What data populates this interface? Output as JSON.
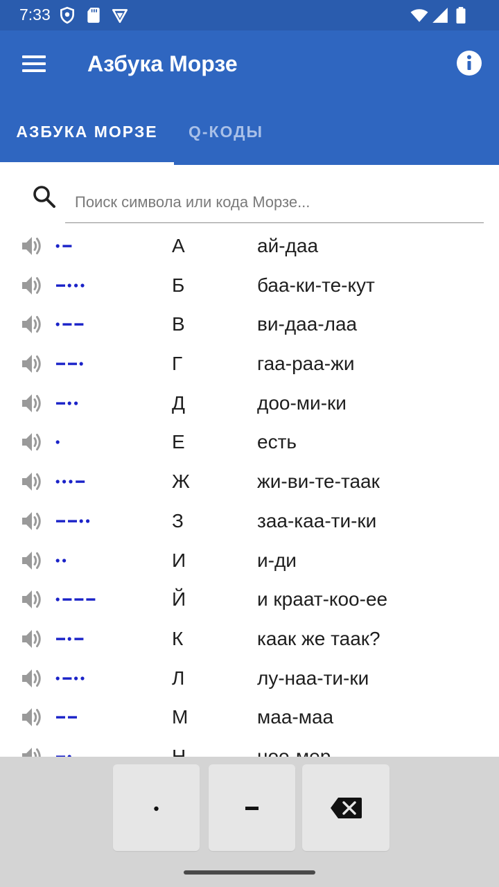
{
  "status": {
    "time": "7:33"
  },
  "appbar": {
    "title": "Азбука Морзе"
  },
  "tabs": [
    {
      "label": "АЗБУКА МОРЗЕ",
      "active": true
    },
    {
      "label": "Q-КОДЫ",
      "active": false
    }
  ],
  "search": {
    "value": "",
    "placeholder": "Поиск символа или кода Морзе..."
  },
  "colors": {
    "primary": "#2f66c0",
    "status": "#2a5cae",
    "morse": "#1a22c8",
    "speaker": "#9a9a9a"
  },
  "rows": [
    {
      "code": ".-",
      "letter": "А",
      "mnemonic": "ай-даа"
    },
    {
      "code": "-...",
      "letter": "Б",
      "mnemonic": "баа-ки-те-кут"
    },
    {
      "code": ".--",
      "letter": "В",
      "mnemonic": "ви-даа-лаа"
    },
    {
      "code": "--.",
      "letter": "Г",
      "mnemonic": "гаа-раа-жи"
    },
    {
      "code": "-..",
      "letter": "Д",
      "mnemonic": "доо-ми-ки"
    },
    {
      "code": ".",
      "letter": "Е",
      "mnemonic": "есть"
    },
    {
      "code": "...-",
      "letter": "Ж",
      "mnemonic": "жи-ви-те-таак"
    },
    {
      "code": "--..",
      "letter": "З",
      "mnemonic": "заа-каа-ти-ки"
    },
    {
      "code": "..",
      "letter": "И",
      "mnemonic": "и-ди"
    },
    {
      "code": ".---",
      "letter": "Й",
      "mnemonic": "и краат-коо-ее"
    },
    {
      "code": "-.-",
      "letter": "К",
      "mnemonic": "каак же таак?"
    },
    {
      "code": ".-..",
      "letter": "Л",
      "mnemonic": "лу-наа-ти-ки"
    },
    {
      "code": "--",
      "letter": "М",
      "mnemonic": "маа-маа"
    },
    {
      "code": "-.",
      "letter": "Н",
      "mnemonic": "ноо-мер"
    }
  ],
  "keypad": {
    "dot_icon": "dot-key-icon",
    "dash_icon": "dash-key-icon",
    "back_icon": "backspace-icon"
  }
}
